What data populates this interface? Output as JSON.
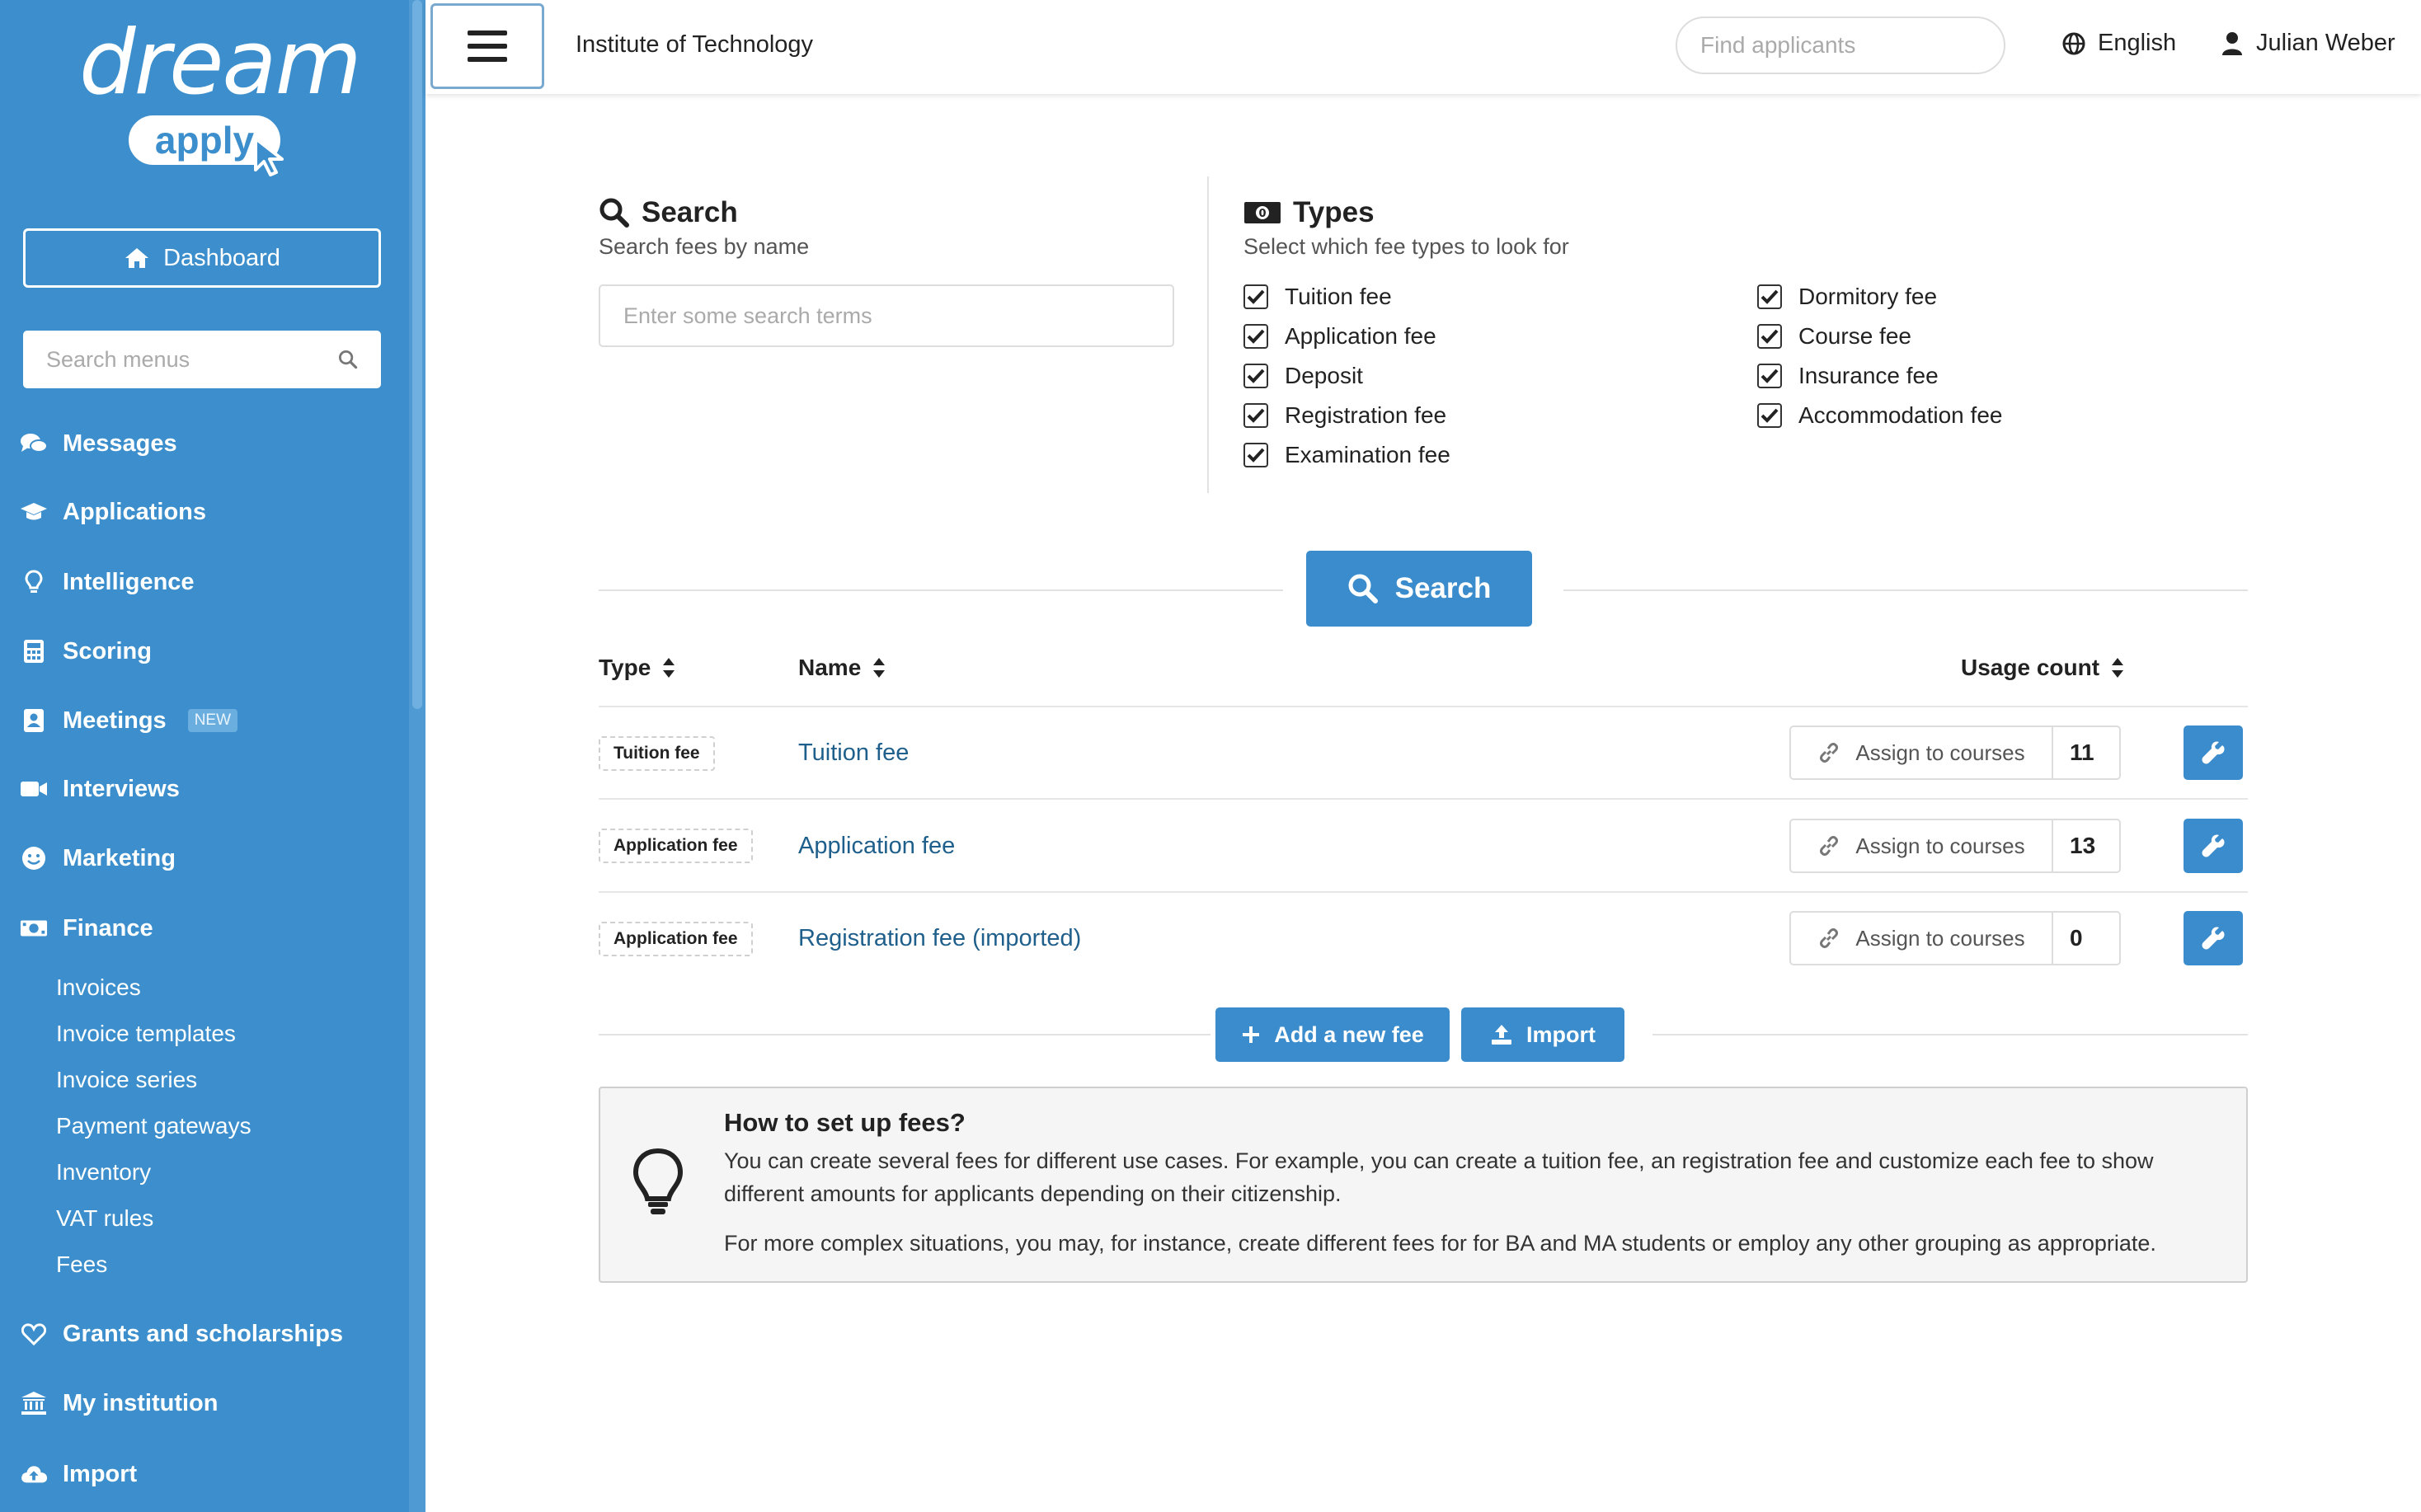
{
  "brand": {
    "word1": "dream",
    "word2": "apply"
  },
  "sidebar": {
    "dashboard_label": "Dashboard",
    "search_placeholder": "Search menus",
    "items": [
      {
        "label": "Messages",
        "icon": "comments-icon"
      },
      {
        "label": "Applications",
        "icon": "graduation-cap-icon"
      },
      {
        "label": "Intelligence",
        "icon": "lightbulb-icon"
      },
      {
        "label": "Scoring",
        "icon": "calculator-icon"
      },
      {
        "label": "Meetings",
        "icon": "address-card-icon",
        "badge": "NEW"
      },
      {
        "label": "Interviews",
        "icon": "video-icon"
      },
      {
        "label": "Marketing",
        "icon": "smile-icon"
      },
      {
        "label": "Finance",
        "icon": "money-bill-icon"
      },
      {
        "label": "Grants and scholarships",
        "icon": "heart-icon"
      },
      {
        "label": "My institution",
        "icon": "institution-icon"
      },
      {
        "label": "Import",
        "icon": "cloud-upload-icon"
      }
    ],
    "finance_sub": [
      "Invoices",
      "Invoice templates",
      "Invoice series",
      "Payment gateways",
      "Inventory",
      "VAT rules",
      "Fees"
    ]
  },
  "topbar": {
    "institution": "Institute of Technology",
    "find_placeholder": "Find applicants",
    "language": "English",
    "user": "Julian Weber"
  },
  "search_section": {
    "title": "Search",
    "subtitle": "Search fees by name",
    "placeholder": "Enter some search terms"
  },
  "types_section": {
    "title": "Types",
    "subtitle": "Select which fee types to look for",
    "col1": [
      {
        "label": "Tuition fee",
        "checked": true
      },
      {
        "label": "Application fee",
        "checked": true
      },
      {
        "label": "Deposit",
        "checked": true
      },
      {
        "label": "Registration fee",
        "checked": true
      },
      {
        "label": "Examination fee",
        "checked": true
      }
    ],
    "col2": [
      {
        "label": "Dormitory fee",
        "checked": true
      },
      {
        "label": "Course fee",
        "checked": true
      },
      {
        "label": "Insurance fee",
        "checked": true
      },
      {
        "label": "Accommodation fee",
        "checked": true
      }
    ]
  },
  "search_button": "Search",
  "table": {
    "headers": {
      "type": "Type",
      "name": "Name",
      "usage": "Usage count"
    },
    "rows": [
      {
        "type": "Tuition fee",
        "name": "Tuition fee",
        "assign": "Assign to courses",
        "count": "11"
      },
      {
        "type": "Application fee",
        "name": "Application fee",
        "assign": "Assign to courses",
        "count": "13"
      },
      {
        "type": "Application fee",
        "name": "Registration fee (imported)",
        "assign": "Assign to courses",
        "count": "0"
      }
    ]
  },
  "actions": {
    "add": "Add a new fee",
    "import": "Import"
  },
  "info": {
    "title": "How to set up fees?",
    "p1": "You can create several fees for different use cases. For example, you can create a tuition fee, an registration fee and customize each fee to show different amounts for applicants depending on their citizenship.",
    "p2": "For more complex situations, you may, for instance, create different fees for for BA and MA students or employ any other grouping as appropriate."
  },
  "colors": {
    "sidebar": "#3c8fcc",
    "primary": "#3a8ccc",
    "link": "#1f5f8b"
  }
}
